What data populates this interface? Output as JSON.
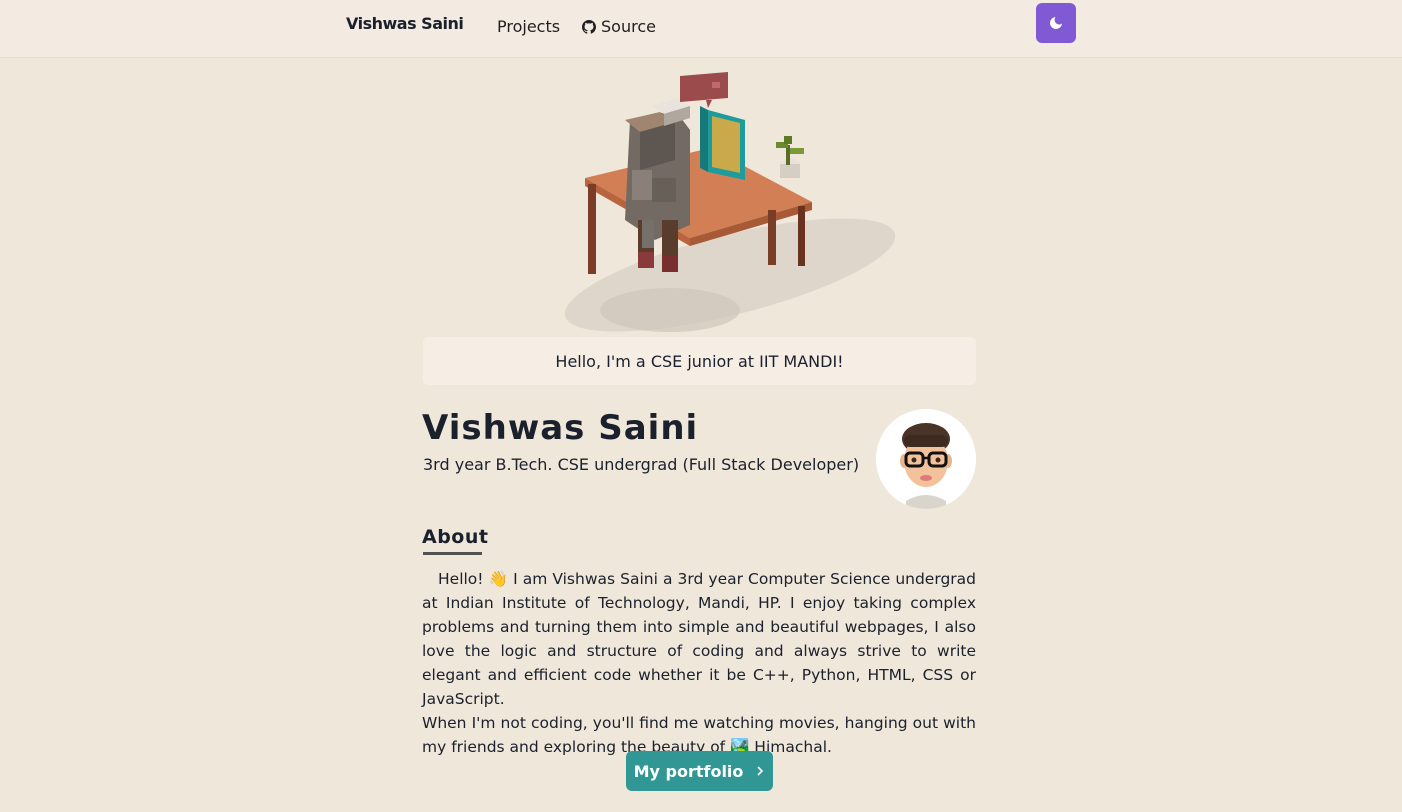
{
  "nav": {
    "brand": "Vishwas Saini",
    "projects_label": "Projects",
    "source_label": "Source",
    "source_icon": "github-icon",
    "theme_icon": "moon-icon"
  },
  "hero": {
    "image": "voxel-desk-illustration",
    "greeting": "Hello, I'm a CSE junior at IIT MANDI!"
  },
  "profile": {
    "name": "Vishwas Saini",
    "subtitle": "3rd year B.Tech. CSE undergrad (Full Stack Developer)",
    "avatar_icon": "memoji-avatar"
  },
  "about": {
    "heading": "About",
    "paragraph1": "Hello! 👋 I am Vishwas Saini a 3rd year Computer Science undergrad at Indian Institute of Technology, Mandi, HP. I enjoy taking complex problems and turning them into simple and beautiful webpages, I also love the logic and structure of coding and always strive to write elegant and efficient code whether it be C++, Python, HTML, CSS or JavaScript.",
    "paragraph2": "When I'm not coding, you'll find me watching movies, hanging out with my friends and exploring the beauty of 🏞️ Himachal."
  },
  "cta": {
    "label": "My portfolio",
    "icon": "chevron-right-icon"
  },
  "colors": {
    "background": "#f0e7db",
    "theme_button": "#805ad5",
    "cta_button": "#319795"
  }
}
